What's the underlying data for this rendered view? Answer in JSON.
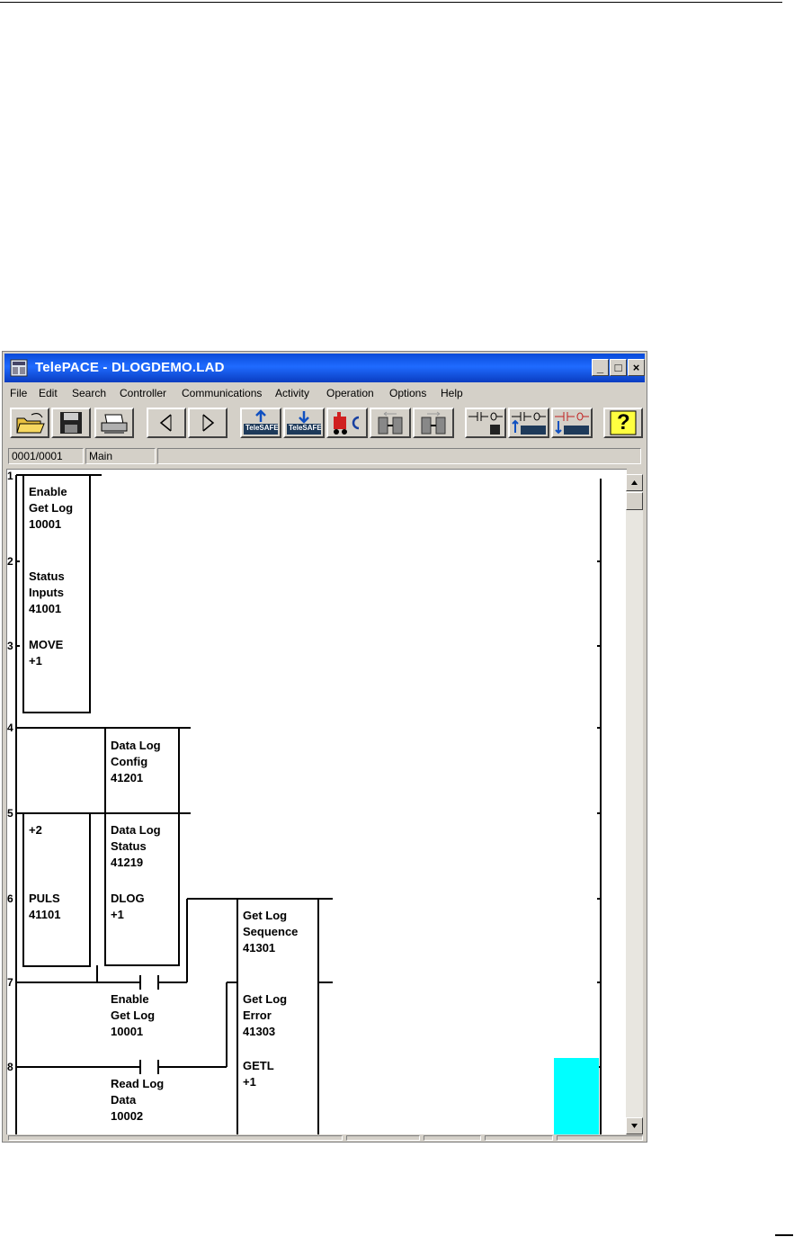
{
  "window": {
    "title": "TelePACE - DLOGDEMO.LAD",
    "controls": {
      "minimize": "_",
      "maximize": "□",
      "close": "×"
    }
  },
  "menu": [
    "File",
    "Edit",
    "Search",
    "Controller",
    "Communications",
    "Activity",
    "Operation",
    "Options",
    "Help"
  ],
  "toolbar": {
    "telesafe_label": "TeleSAFE",
    "buttons": [
      "open-folder-icon",
      "save-disk-icon",
      "print-icon",
      "previous-arrow-icon",
      "next-arrow-icon",
      "write-telesafe-icon",
      "read-telesafe-icon",
      "controller-c-icon",
      "network-left-icon",
      "network-right-icon",
      "ladder-disk-icon",
      "ladder-write-icon",
      "ladder-read-icon",
      "help-question-icon"
    ],
    "help_glyph": "?"
  },
  "status": {
    "position": "0001/0001",
    "network": "Main",
    "message": ""
  },
  "ladder": {
    "rungs": [
      "1",
      "2",
      "3",
      "4",
      "5",
      "6",
      "7",
      "8"
    ],
    "blocks": {
      "move": {
        "in": [
          "Enable",
          "Get Log",
          "10001"
        ],
        "dest": [
          "Status",
          "Inputs",
          "41001"
        ],
        "op": [
          "MOVE",
          "+1"
        ]
      },
      "puls": {
        "top": [
          "+2"
        ],
        "op": [
          "PULS",
          "41101"
        ]
      },
      "dlog": {
        "config": [
          "Data Log",
          "Config",
          "41201"
        ],
        "status": [
          "Data Log",
          "Status",
          "41219"
        ],
        "op": [
          "DLOG",
          "+1"
        ]
      },
      "getl": {
        "seq": [
          "Get Log",
          "Sequence",
          "41301"
        ],
        "err": [
          "Get Log",
          "Error",
          "41303"
        ],
        "op": [
          "GETL",
          "+1"
        ]
      }
    },
    "contacts": {
      "enable": [
        "Enable",
        "Get Log",
        "10001"
      ],
      "read": [
        "Read Log",
        "Data",
        "10002"
      ]
    }
  },
  "colors": {
    "titlebar": "#0a4bd8",
    "cursor": "#00ffff",
    "chrome": "#d4d0c8"
  }
}
